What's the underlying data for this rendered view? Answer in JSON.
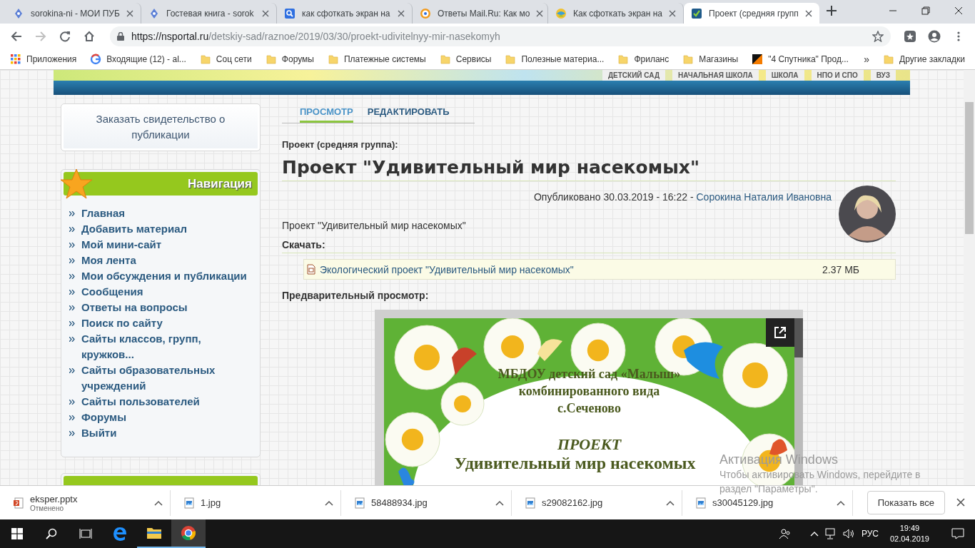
{
  "browser": {
    "tabs": [
      {
        "title": "sorokina-ni - МОИ ПУБ",
        "selected": false
      },
      {
        "title": "Гостевая книга - sorok",
        "selected": false
      },
      {
        "title": "как сфоткать экран на",
        "selected": false
      },
      {
        "title": "Ответы Mail.Ru: Как мо",
        "selected": false
      },
      {
        "title": "Как сфоткать экран на",
        "selected": false
      },
      {
        "title": "Проект (средняя групп",
        "selected": true
      }
    ],
    "url": {
      "host": "https://nsportal.ru",
      "path": "/detskiy-sad/raznoe/2019/03/30/proekt-udivitelnyy-mir-nasekomyh"
    },
    "bookmarks": [
      {
        "label": "Приложения",
        "kind": "apps"
      },
      {
        "label": "Входящие (12) - al...",
        "kind": "google"
      },
      {
        "label": "Соц сети",
        "kind": "folder"
      },
      {
        "label": "Форумы",
        "kind": "folder"
      },
      {
        "label": "Платежные системы",
        "kind": "folder"
      },
      {
        "label": "Сервисы",
        "kind": "folder"
      },
      {
        "label": "Полезные материа...",
        "kind": "folder"
      },
      {
        "label": "Фриланс",
        "kind": "folder"
      },
      {
        "label": "Магазины",
        "kind": "folder"
      },
      {
        "label": "\"4 Спутника\" Прод...",
        "kind": "site"
      }
    ],
    "bookmarks_overflow": "»",
    "other_bookmarks": "Другие закладки"
  },
  "site": {
    "top_nav": [
      "ДЕТСКИЙ САД",
      "НАЧАЛЬНАЯ ШКОЛА",
      "ШКОЛА",
      "НПО И СПО",
      "ВУЗ"
    ],
    "certificate_button": "Заказать свидетельство о публикации",
    "nav_title": "Навигация",
    "nav_items": [
      "Главная",
      "Добавить материал",
      "Мой мини-сайт",
      "Моя лента",
      "Мои обсуждения и публикации",
      "Сообщения",
      "Ответы на вопросы",
      "Поиск по сайту",
      "Сайты классов, групп, кружков...",
      "Сайты образовательных учреждений",
      "Сайты пользователей",
      "Форумы",
      "Выйти"
    ],
    "view_tabs": [
      {
        "label": "ПРОСМОТР",
        "selected": true
      },
      {
        "label": "РЕДАКТИРОВАТЬ",
        "selected": false
      }
    ],
    "category": "Проект (средняя группа):",
    "title": "Проект \"Удивительный мир насекомых\"",
    "published": "Опубликовано 30.03.2019 - 16:22 -",
    "author": "Сорокина Наталия Ивановна",
    "summary": "Проект \"Удивительный мир насекомых\"",
    "download_label": "Скачать:",
    "file": {
      "name": "Экологический проект \"Удивительный мир насекомых\"",
      "size": "2.37 МБ"
    },
    "preview_label": "Предварительный просмотр:",
    "slide": {
      "lines": [
        "МБДОУ детский сад «Малыш»",
        "комбинированного вида",
        "с.Сеченово"
      ],
      "kind_label": "ПРОЕКТ",
      "title": "Удивительный мир насекомых"
    }
  },
  "activation": {
    "title": "Активация Windows",
    "text": "Чтобы активировать Windows, перейдите в раздел \"Параметры\"."
  },
  "downloads": {
    "items": [
      {
        "name": "eksper.pptx",
        "status": "Отменено",
        "kind": "pptx"
      },
      {
        "name": "1.jpg"
      },
      {
        "name": "58488934.jpg"
      },
      {
        "name": "s29082162.jpg"
      },
      {
        "name": "s30045129.jpg"
      }
    ],
    "show_all": "Показать все"
  },
  "taskbar": {
    "language": "РУС",
    "time": "19:49",
    "date": "02.04.2019"
  }
}
